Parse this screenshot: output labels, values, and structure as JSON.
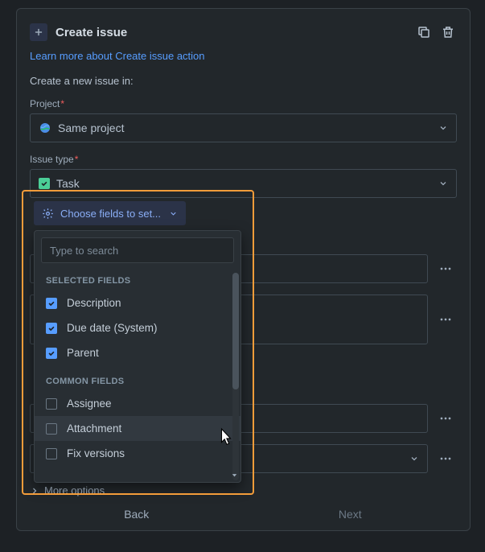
{
  "header": {
    "title": "Create issue"
  },
  "link_text": "Learn more about Create issue action",
  "intro": "Create a new issue in:",
  "project": {
    "label": "Project",
    "value": "Same project"
  },
  "issue_type": {
    "label": "Issue type",
    "value": "Task"
  },
  "choose_button": "Choose fields to set...",
  "search_placeholder": "Type to search",
  "sections": {
    "selected_label": "SELECTED FIELDS",
    "common_label": "COMMON FIELDS"
  },
  "selected_fields": [
    {
      "label": "Description"
    },
    {
      "label": "Due date (System)"
    },
    {
      "label": "Parent"
    }
  ],
  "common_fields": [
    {
      "label": "Assignee"
    },
    {
      "label": "Attachment"
    },
    {
      "label": "Fix versions"
    }
  ],
  "more_options": "More options",
  "footer": {
    "back": "Back",
    "next": "Next"
  }
}
